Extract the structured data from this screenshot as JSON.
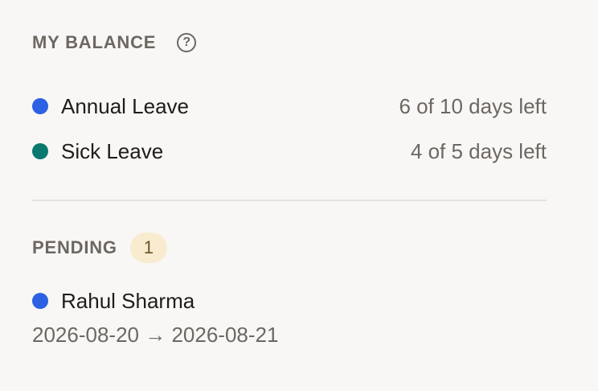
{
  "colors": {
    "annual": "#2c61e3",
    "sick": "#0b786f",
    "request": "#2c61e3"
  },
  "balance": {
    "title": "MY BALANCE",
    "help_icon": "question-circle-icon",
    "help_glyph": "?",
    "items": [
      {
        "label": "Annual Leave",
        "value": "6 of 10 days left"
      },
      {
        "label": "Sick Leave",
        "value": "4 of 5 days left"
      }
    ]
  },
  "pending": {
    "title": "PENDING",
    "count": "1",
    "requests": [
      {
        "name": "Rahul Sharma",
        "dates": "2026-08-20 → 2026-08-21"
      }
    ]
  }
}
